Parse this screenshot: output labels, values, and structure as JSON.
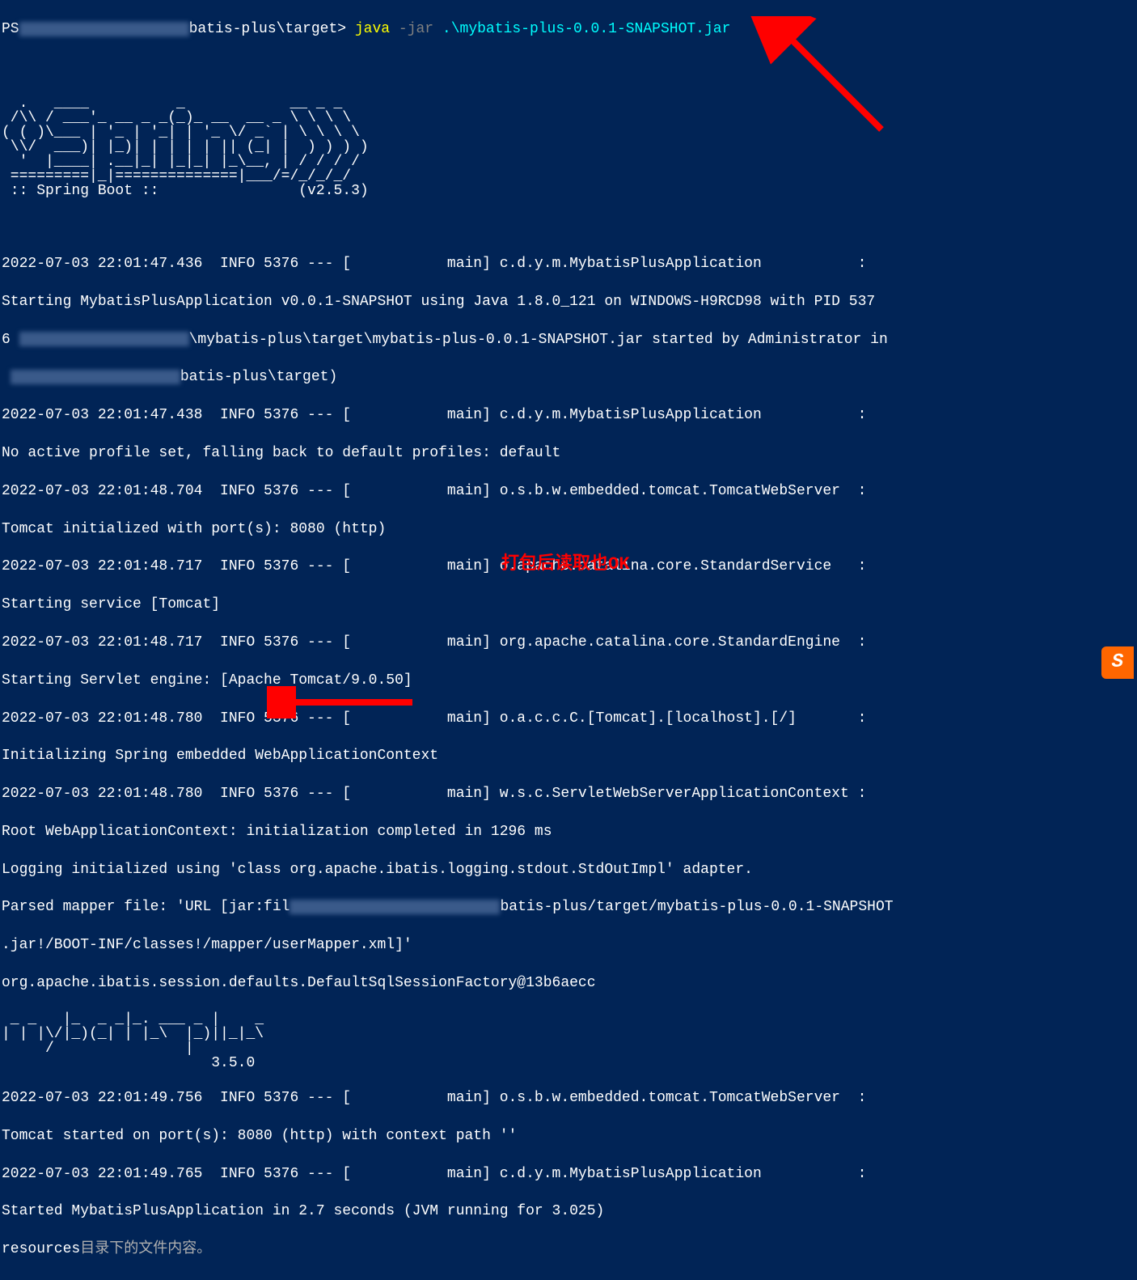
{
  "prompt": {
    "ps": "PS",
    "path": "batis-plus\\target>",
    "cmd": "java",
    "flag": "-jar",
    "arg": ".\\mybatis-plus-0.0.1-SNAPSHOT.jar"
  },
  "spring_banner": {
    "line1": "  .   ____          _            __ _ _",
    "line2": " /\\\\ / ___'_ __ _ _(_)_ __  __ _ \\ \\ \\ \\",
    "line3": "( ( )\\___ | '_ | '_| | '_ \\/ _` | \\ \\ \\ \\",
    "line4": " \\\\/  ___)| |_)| | | | | || (_| |  ) ) ) )",
    "line5": "  '  |____| .__|_| |_|_| |_\\__, | / / / /",
    "line6": " =========|_|==============|___/=/_/_/_/",
    "line7": " :: Spring Boot ::                (v2.5.3)"
  },
  "logs": {
    "l1": "2022-07-03 22:01:47.436  INFO 5376 --- [           main] c.d.y.m.MybatisPlusApplication           : ",
    "l2a": "Starting MybatisPlusApplication v0.0.1-SNAPSHOT using Java 1.8.0_121 on WINDOWS-H9RCD98 with PID 537",
    "l2b": "6 ",
    "l2c": "\\mybatis-plus\\target\\mybatis-plus-0.0.1-SNAPSHOT.jar started by Administrator in",
    "l2d": " ",
    "l2e": "batis-plus\\target)",
    "l3": "2022-07-03 22:01:47.438  INFO 5376 --- [           main] c.d.y.m.MybatisPlusApplication           : ",
    "l4": "No active profile set, falling back to default profiles: default",
    "l5": "2022-07-03 22:01:48.704  INFO 5376 --- [           main] o.s.b.w.embedded.tomcat.TomcatWebServer  : ",
    "l6": "Tomcat initialized with port(s): 8080 (http)",
    "l7": "2022-07-03 22:01:48.717  INFO 5376 --- [           main] o.apache.catalina.core.StandardService   : ",
    "l8": "Starting service [Tomcat]",
    "l9": "2022-07-03 22:01:48.717  INFO 5376 --- [           main] org.apache.catalina.core.StandardEngine  : ",
    "l10": "Starting Servlet engine: [Apache Tomcat/9.0.50]",
    "l11": "2022-07-03 22:01:48.780  INFO 5376 --- [           main] o.a.c.c.C.[Tomcat].[localhost].[/]       : ",
    "l12": "Initializing Spring embedded WebApplicationContext",
    "l13": "2022-07-03 22:01:48.780  INFO 5376 --- [           main] w.s.c.ServletWebServerApplicationContext : ",
    "l14": "Root WebApplicationContext: initialization completed in 1296 ms",
    "l15": "Logging initialized using 'class org.apache.ibatis.logging.stdout.StdOutImpl' adapter.",
    "l16a": "Parsed mapper file: 'URL [jar:fil",
    "l16b": "batis-plus/target/mybatis-plus-0.0.1-SNAPSHOT",
    "l17": ".jar!/BOOT-INF/classes!/mapper/userMapper.xml]'",
    "l18": "org.apache.ibatis.session.defaults.DefaultSqlSessionFactory@13b6aecc"
  },
  "mybatis_banner": {
    "l1": " _ _   |_  _ _|_. ___ _ |    _ ",
    "l2": "| | |\\/|_)(_| | |_\\  |_)||_|_\\ ",
    "l3": "     /               |         ",
    "l4": "                        3.5.0 "
  },
  "logs2": {
    "l1": "2022-07-03 22:01:49.756  INFO 5376 --- [           main] o.s.b.w.embedded.tomcat.TomcatWebServer  : ",
    "l2": "Tomcat started on port(s): 8080 (http) with context path ''",
    "l3": "2022-07-03 22:01:49.765  INFO 5376 --- [           main] c.d.y.m.MybatisPlusApplication           : ",
    "l4": "Started MybatisPlusApplication in 2.7 seconds (JVM running for 3.025)",
    "l5a": "resources",
    "l5b": "目录下的文件内容。"
  },
  "annotations": {
    "red1": "打包后读取也OK"
  }
}
